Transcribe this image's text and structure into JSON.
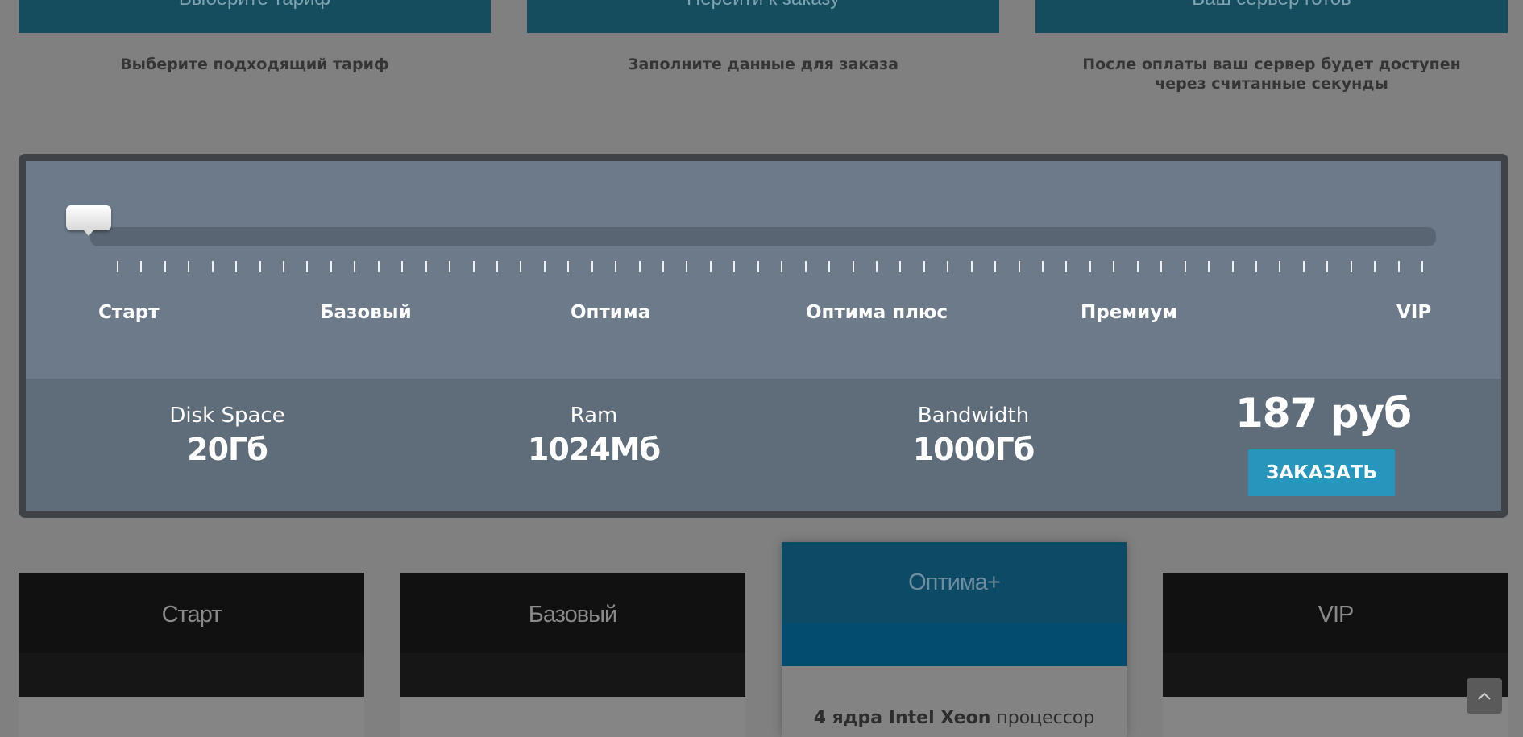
{
  "steps": [
    {
      "button": "Выберите тариф",
      "caption": "Выберите подходящий тариф"
    },
    {
      "button": "Перейти к заказу",
      "caption": "Заполните данные для заказа"
    },
    {
      "button": "Ваш сервер готов",
      "caption": "После оплаты ваш сервер будет доступен через считанные секунды"
    }
  ],
  "calculator": {
    "slider_position": 0,
    "tiers": [
      "Старт",
      "Базовый",
      "Оптима",
      "Оптима плюс",
      "Премиум",
      "VIP"
    ],
    "specs": [
      {
        "label": "Disk Space",
        "value": "20Гб"
      },
      {
        "label": "Ram",
        "value": "1024Мб"
      },
      {
        "label": "Bandwidth",
        "value": "1000Гб"
      }
    ],
    "price": "187 руб",
    "order_label": "ЗАКАЗАТЬ"
  },
  "plans": [
    "Старт",
    "Базовый",
    "Оптима+",
    "VIP"
  ],
  "featured_plan": {
    "name": "Оптима+",
    "feature_bold": "4 ядра Intel Xeon",
    "feature_rest": " процессор"
  },
  "colors": {
    "calc_bg": "#6c7a8a",
    "order_button": "#2796bd",
    "featured_header": "#0d4a66"
  },
  "icons": {
    "scroll_top": "chevron-up-icon"
  }
}
